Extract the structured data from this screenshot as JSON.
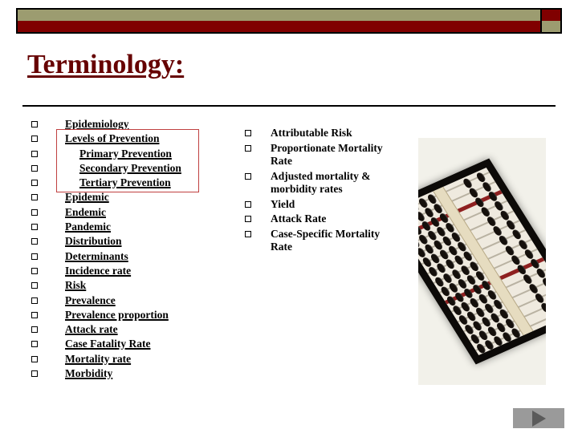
{
  "slide": {
    "title": "Terminology:"
  },
  "banner": {
    "olive_color": "#9c9c70",
    "red_color": "#800000",
    "border_color": "#000000"
  },
  "left_column": {
    "items": [
      {
        "label": "Epidemiology",
        "indented": false
      },
      {
        "label": "Levels of Prevention",
        "indented": false
      },
      {
        "label": "Primary Prevention",
        "indented": true
      },
      {
        "label": "Secondary Prevention",
        "indented": true
      },
      {
        "label": "Tertiary Prevention",
        "indented": true
      },
      {
        "label": "Epidemic",
        "indented": false
      },
      {
        "label": "Endemic",
        "indented": false
      },
      {
        "label": "Pandemic",
        "indented": false
      },
      {
        "label": "Distribution",
        "indented": false
      },
      {
        "label": "Determinants",
        "indented": false
      },
      {
        "label": "Incidence rate",
        "indented": false
      },
      {
        "label": "Risk",
        "indented": false
      },
      {
        "label": "Prevalence",
        "indented": false
      },
      {
        "label": "Prevalence proportion",
        "indented": false
      },
      {
        "label": "Attack rate",
        "indented": false
      },
      {
        "label": "Case Fatality Rate",
        "indented": false
      },
      {
        "label": "Mortality rate",
        "indented": false
      },
      {
        "label": "Morbidity",
        "indented": false
      }
    ]
  },
  "right_column": {
    "items": [
      {
        "label": "Attributable Risk"
      },
      {
        "label": "Proportionate Mortality Rate"
      },
      {
        "label": "Adjusted mortality & morbidity rates"
      },
      {
        "label": "Yield"
      },
      {
        "label": "Attack Rate"
      },
      {
        "label": "Case-Specific Mortality Rate"
      }
    ]
  },
  "highlight": {
    "color": "#c04040"
  },
  "photo": {
    "alt": "abacus-photo"
  },
  "navigation": {
    "next_label": ""
  }
}
